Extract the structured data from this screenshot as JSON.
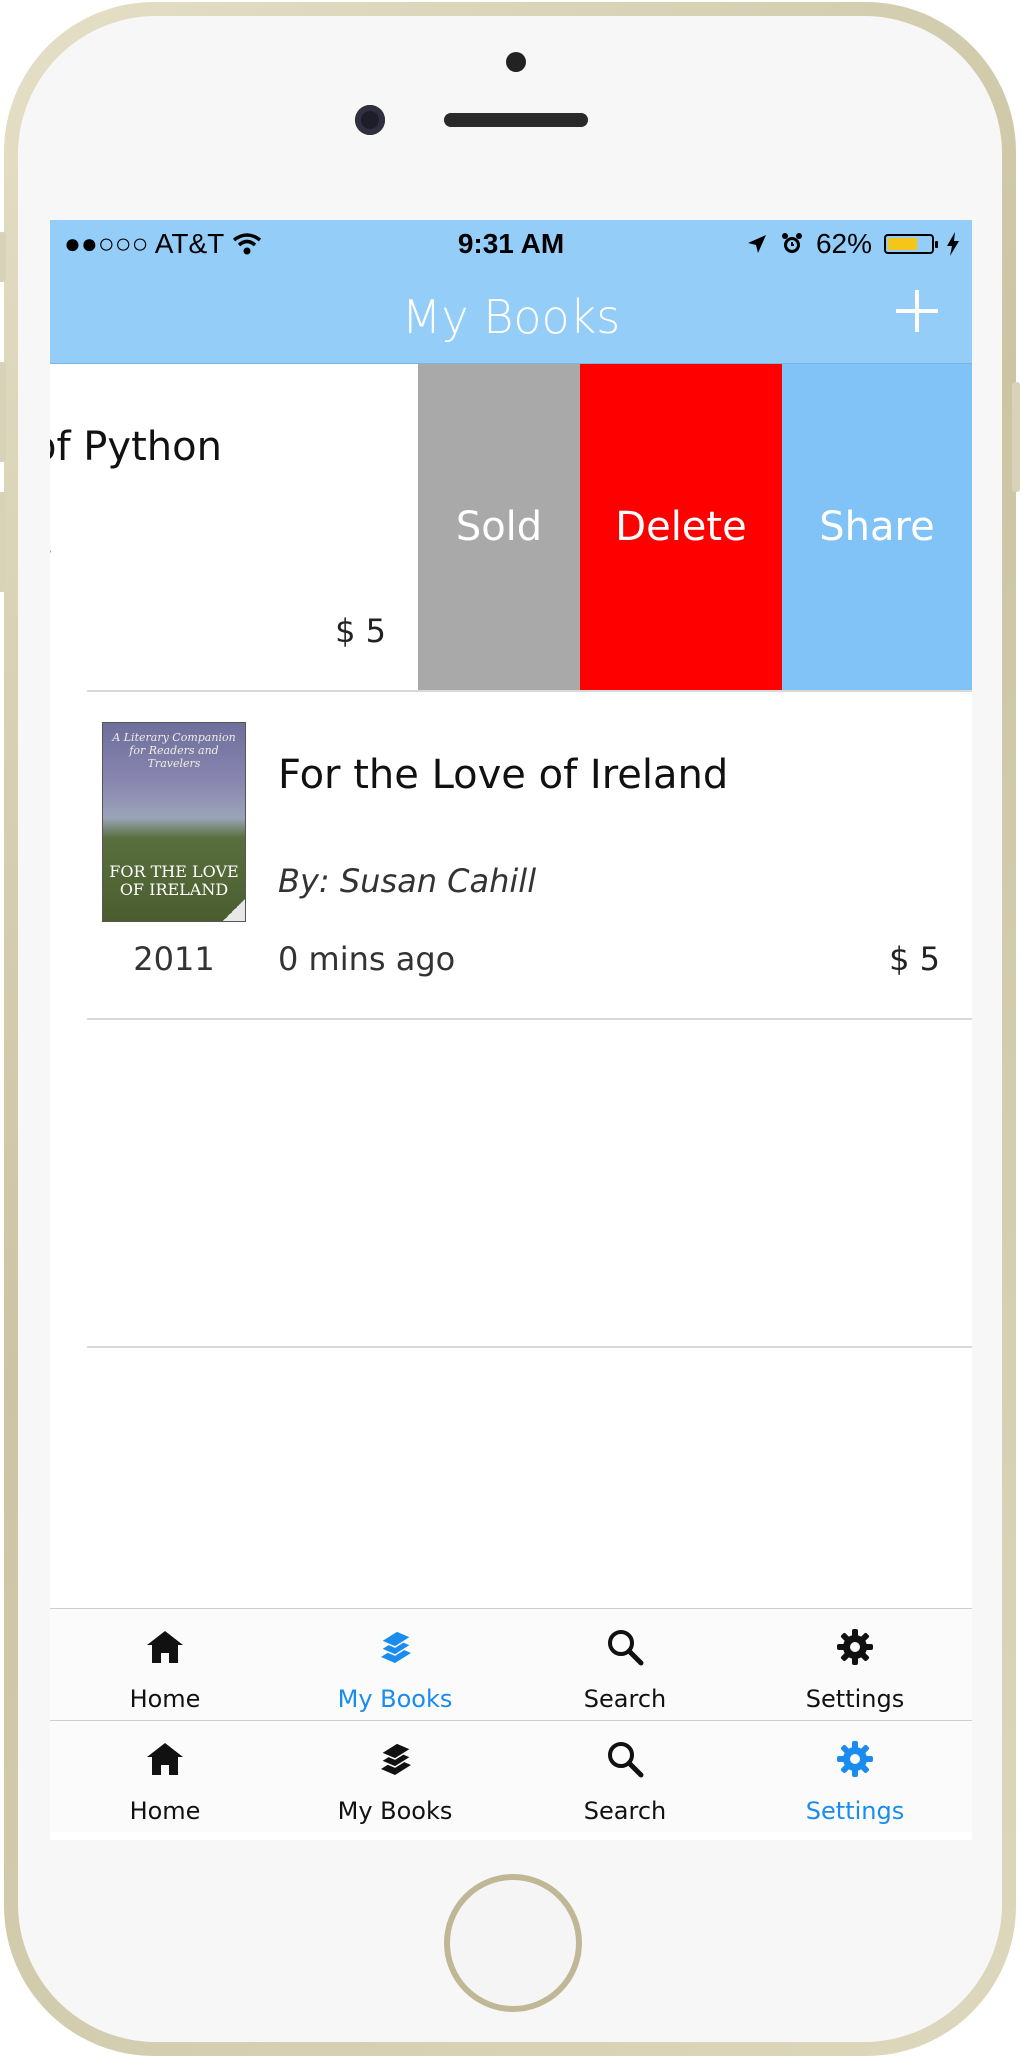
{
  "status_bar": {
    "carrier": "●●○○○ AT&T",
    "time": "9:31 AM",
    "battery": "62%"
  },
  "nav": {
    "title": "My Books"
  },
  "rows": [
    {
      "title": "of Python",
      "author": "rt",
      "price": "$ 5",
      "actions": {
        "sold": "Sold",
        "delete": "Delete",
        "share": "Share"
      }
    },
    {
      "title": "For the Love of Ireland",
      "author": "By: Susan Cahill",
      "year": "2011",
      "time": "0 mins ago",
      "price": "$ 5",
      "cover": {
        "top_text": "A Literary Companion for Readers and Travelers",
        "title": "FOR THE LOVE OF IRELAND"
      }
    }
  ],
  "tabbar_upper": {
    "items": [
      {
        "label": "Home",
        "icon": "home-icon"
      },
      {
        "label": "My Books",
        "icon": "books-icon",
        "active": true
      },
      {
        "label": "Search",
        "icon": "search-icon"
      },
      {
        "label": "Settings",
        "icon": "gear-icon"
      }
    ]
  },
  "tabbar_lower": {
    "items": [
      {
        "label": "Home",
        "icon": "home-icon"
      },
      {
        "label": "My Books",
        "icon": "books-icon"
      },
      {
        "label": "Search",
        "icon": "search-icon"
      },
      {
        "label": "Settings",
        "icon": "gear-icon",
        "active": true
      }
    ]
  },
  "colors": {
    "navbar": "#93cdf8",
    "sold": "#a9a9a9",
    "delete": "#ff0000",
    "share": "#82c3f7",
    "active_tab": "#1a8cf0"
  }
}
